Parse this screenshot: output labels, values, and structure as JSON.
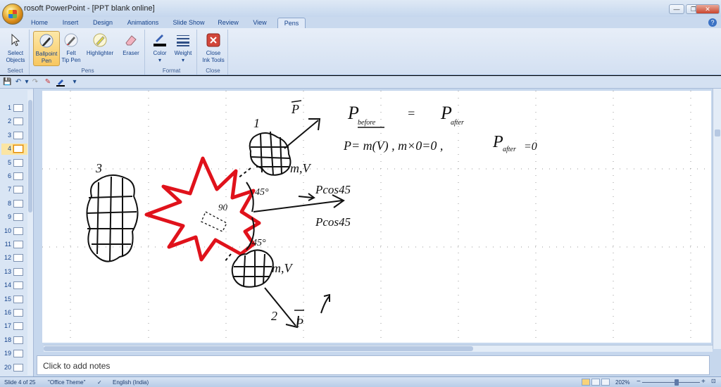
{
  "window": {
    "title": "rosoft PowerPoint - [PPT blank online]",
    "minimize": "—",
    "restore": "❐",
    "close": "✕"
  },
  "tabs": [
    {
      "label": "Home"
    },
    {
      "label": "Insert"
    },
    {
      "label": "Design"
    },
    {
      "label": "Animations"
    },
    {
      "label": "Slide Show"
    },
    {
      "label": "Review"
    },
    {
      "label": "View"
    },
    {
      "label": "Pens"
    }
  ],
  "help": "?",
  "ribbon": {
    "select": {
      "label_line1": "Select",
      "label_line2": "Objects",
      "group": "Select"
    },
    "pens_group": "Pens",
    "ballpoint": {
      "l1": "Ballpoint",
      "l2": "Pen"
    },
    "felt": {
      "l1": "Felt",
      "l2": "Tip Pen"
    },
    "highlighter": {
      "l1": "Highlighter"
    },
    "eraser": {
      "l1": "Eraser"
    },
    "format_group": "Format",
    "color": {
      "l1": "Color",
      "l2": "▾"
    },
    "weight": {
      "l1": "Weight",
      "l2": "▾"
    },
    "close_group": "Close",
    "close_ink": {
      "l1": "Close",
      "l2": "Ink Tools"
    }
  },
  "qat": {
    "save": "💾",
    "undo": "↶",
    "undo_dd": "▾",
    "redo": "↷",
    "pen": "✎",
    "custom": "▾"
  },
  "slides": [
    {
      "num": "1"
    },
    {
      "num": "2"
    },
    {
      "num": "3"
    },
    {
      "num": "4"
    },
    {
      "num": "5"
    },
    {
      "num": "6"
    },
    {
      "num": "7"
    },
    {
      "num": "8"
    },
    {
      "num": "9"
    },
    {
      "num": "10"
    },
    {
      "num": "11"
    },
    {
      "num": "12"
    },
    {
      "num": "13"
    },
    {
      "num": "14"
    },
    {
      "num": "15"
    },
    {
      "num": "16"
    },
    {
      "num": "17"
    },
    {
      "num": "18"
    },
    {
      "num": "19"
    },
    {
      "num": "20"
    }
  ],
  "active_slide_index": 3,
  "ink": {
    "p_vec": "P",
    "one": "1",
    "two": "2",
    "three": "3",
    "mv_top": "m,V",
    "mv_bottom": "m,V",
    "deg45_top": "45°",
    "deg45_bottom": "45°",
    "ninety": "90",
    "pcos_top": "Pcos45",
    "pcos_bottom": "Pcos45",
    "p_before": "P",
    "before": "before",
    "equals": "=",
    "p_after": "P",
    "after": "after",
    "eq2": "P= m(V) , m×0=0 ,",
    "p_after2": "P",
    "after2": "after",
    "eq_zero": "=0",
    "p_bottom": "P"
  },
  "notes": {
    "placeholder": "Click to add notes"
  },
  "status": {
    "slide": "Slide 4 of 25",
    "theme": "\"Office Theme\"",
    "language": "English (India)",
    "zoom": "202%",
    "zoom_minus": "−",
    "zoom_plus": "+"
  },
  "colors": {
    "ink": "#111111",
    "burst": "#e0121b",
    "accent": "#f8c760"
  }
}
